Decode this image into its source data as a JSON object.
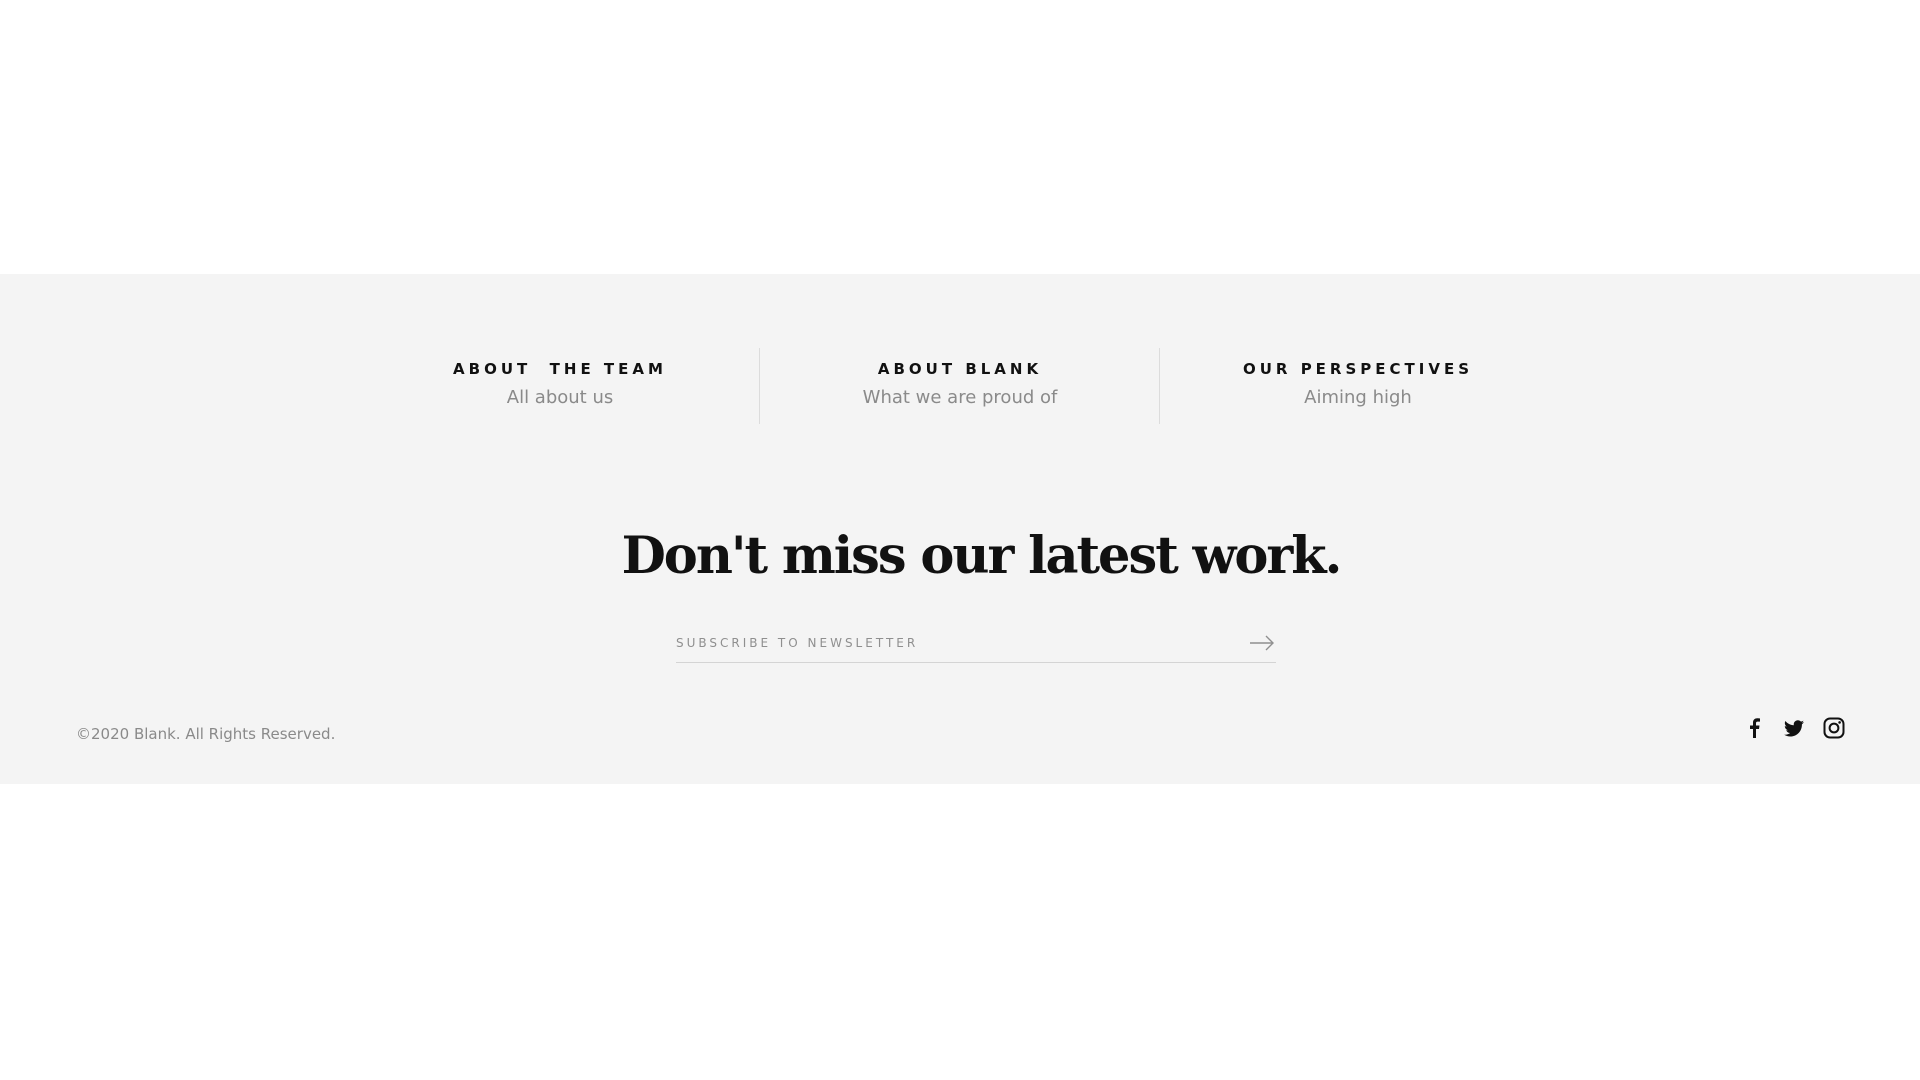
{
  "links": [
    {
      "title": "ABOUT  THE TEAM",
      "subtitle": "All about us"
    },
    {
      "title": "ABOUT BLANK",
      "subtitle": "What we are proud of"
    },
    {
      "title": "OUR PERSPECTIVES",
      "subtitle": "Aiming high"
    }
  ],
  "newsletter": {
    "headline": "Don't miss our latest work.",
    "placeholder": "SUBSCRIBE TO NEWSLETTER",
    "submit_icon": "arrow-right-icon"
  },
  "footer": {
    "copyright": "©2020 Blank. All Rights Reserved."
  },
  "social": [
    {
      "icon": "facebook-icon"
    },
    {
      "icon": "twitter-icon"
    },
    {
      "icon": "instagram-icon"
    }
  ],
  "colors": {
    "footer_bg": "#f4f4f4",
    "text_dark": "#111111",
    "text_muted": "#8a8a8a",
    "divider": "#dcdcdc"
  }
}
